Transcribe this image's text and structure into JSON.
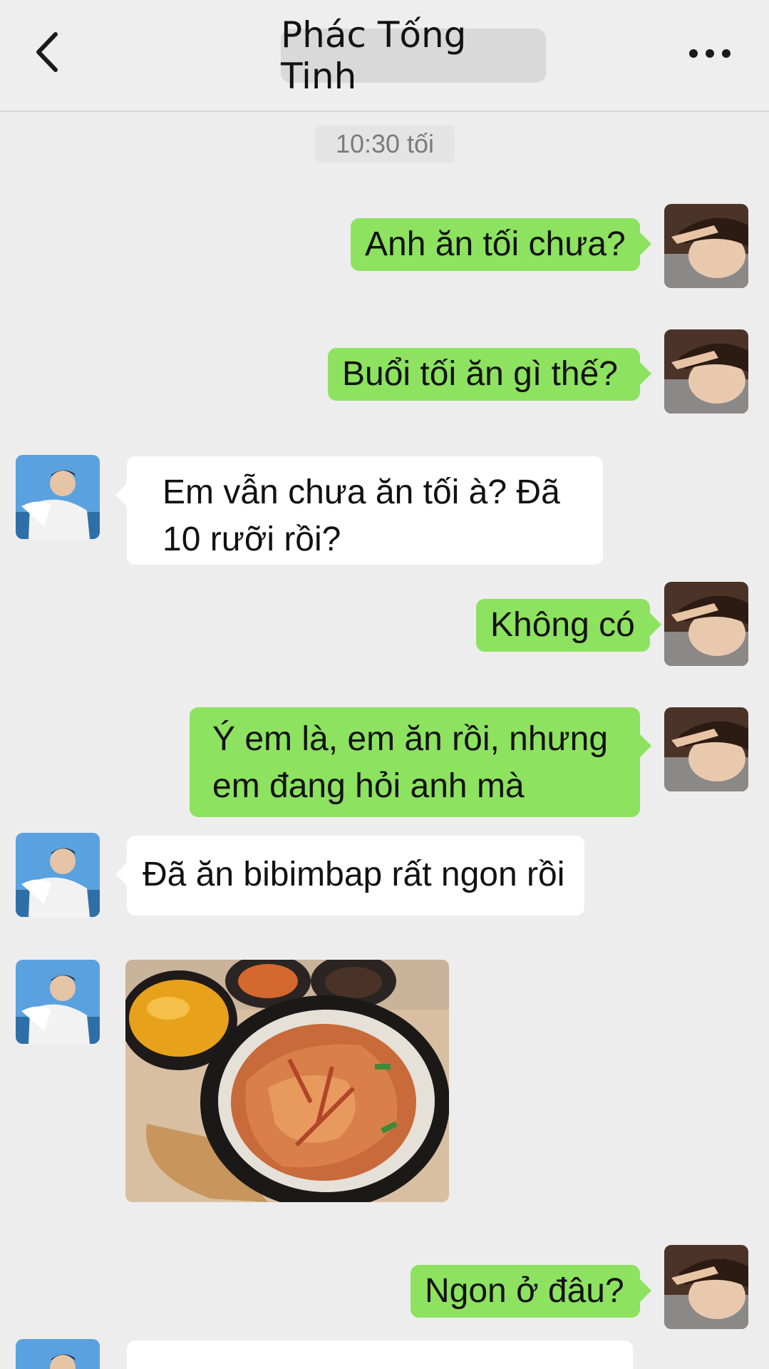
{
  "header": {
    "back_icon": "chevron-left-icon",
    "title": "Phác Tống Tinh",
    "more_icon": "more-horizontal-icon"
  },
  "time_label": "10:30 tối",
  "messages": [
    {
      "side": "out",
      "text": "Anh ăn tối chưa?"
    },
    {
      "side": "out",
      "text": "Buổi tối ăn gì thế?"
    },
    {
      "side": "in",
      "text": "Em vẫn chưa ăn tối à? Đã 10 rưỡi rồi?"
    },
    {
      "side": "out",
      "text": "Không có"
    },
    {
      "side": "out",
      "text": "Ý em là, em ăn rồi, nhưng em đang hỏi anh mà"
    },
    {
      "side": "in",
      "text": "Đã ăn bibimbap rất ngon rồi"
    },
    {
      "side": "in",
      "type": "image",
      "image_subject": "bibimbap-photo"
    },
    {
      "side": "out",
      "text": "Ngon ở đâu?"
    }
  ],
  "colors": {
    "background": "#ededed",
    "outgoing_bubble": "#8de25f",
    "incoming_bubble": "#ffffff",
    "title_pill": "#d9d9d9"
  }
}
